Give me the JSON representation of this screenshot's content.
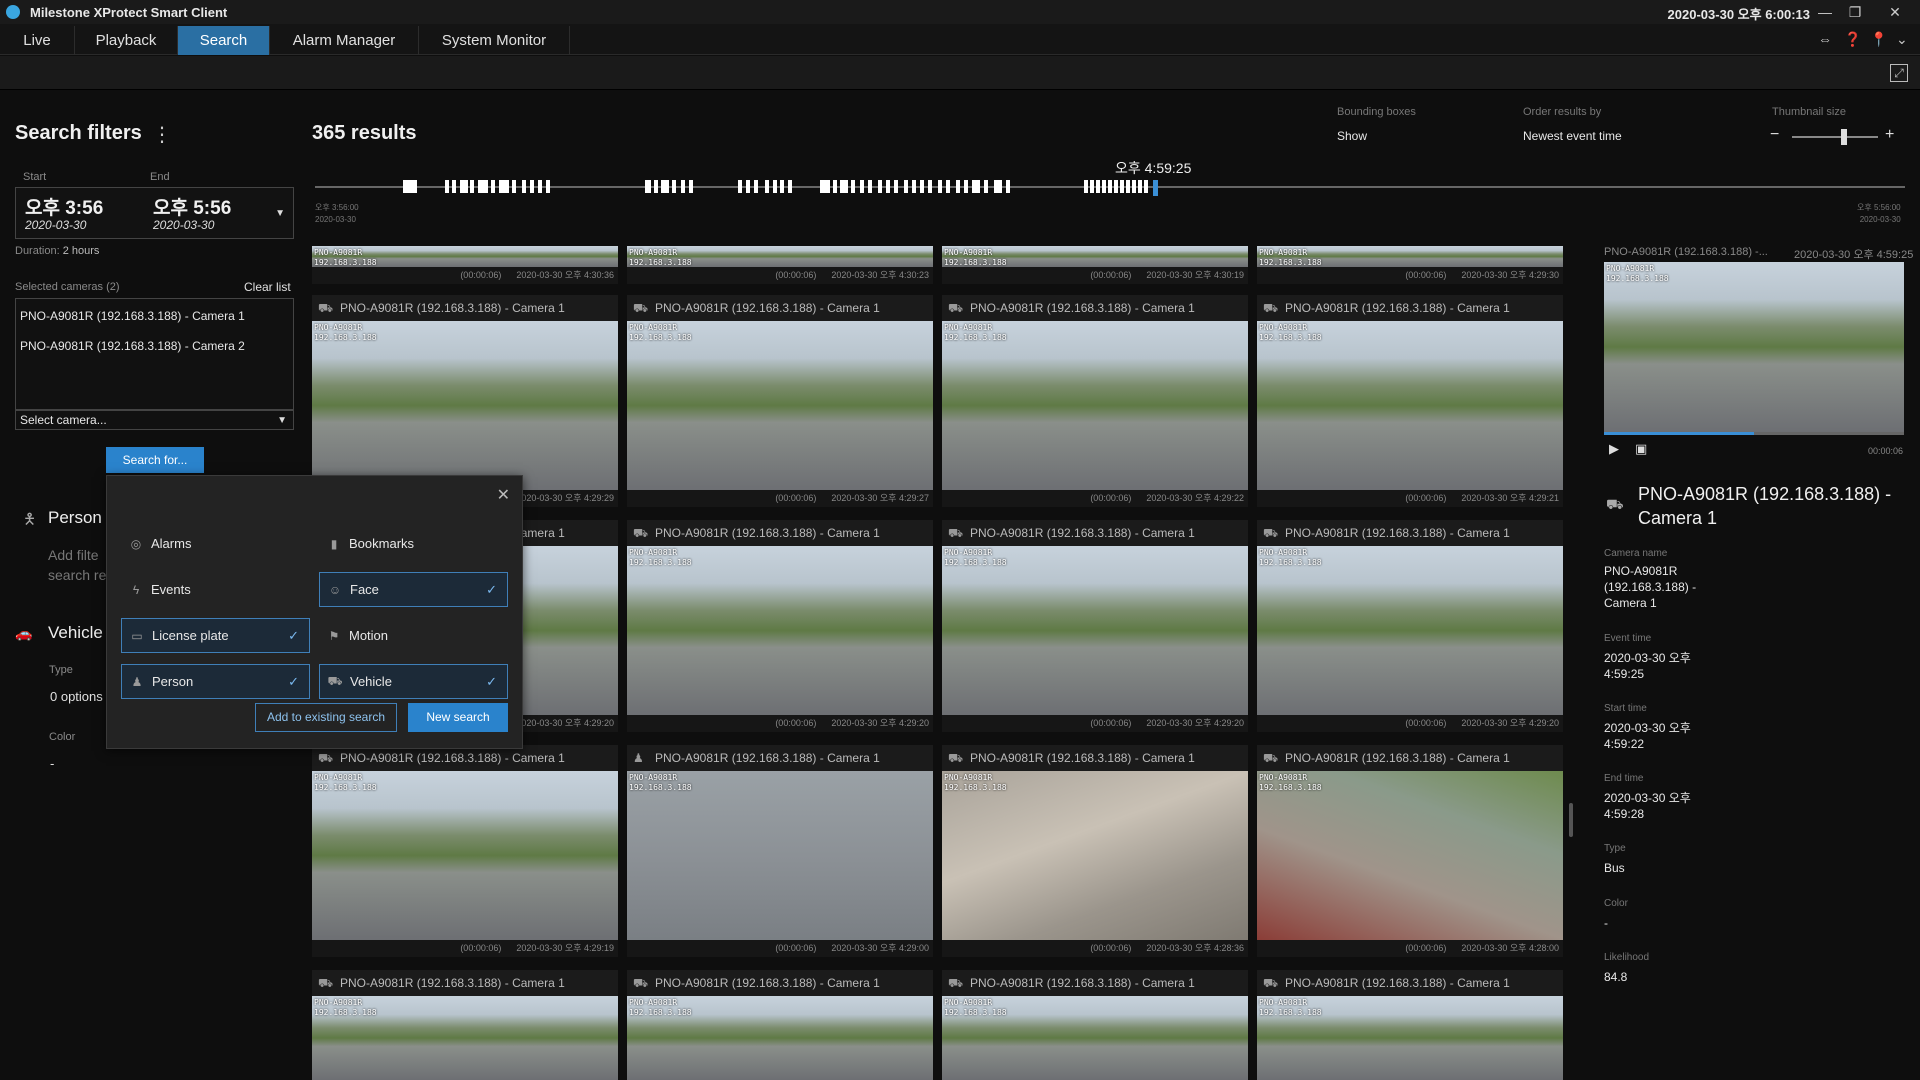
{
  "app": {
    "title": "Milestone XProtect Smart Client",
    "datetime": "2020-03-30 오후 6:00:13",
    "tabs": [
      "Live",
      "Playback",
      "Search",
      "Alarm Manager",
      "System Monitor"
    ]
  },
  "filters": {
    "title": "Search filters",
    "start_label": "Start",
    "end_label": "End",
    "start_time": "오후 3:56",
    "start_date": "2020-03-30",
    "end_time": "오후 5:56",
    "end_date": "2020-03-30",
    "duration_label": "Duration:",
    "duration_value": "2 hours",
    "selected_cameras_label": "Selected cameras (2)",
    "clear_list": "Clear list",
    "cameras": [
      "PNO-A9081R (192.168.3.188) - Camera 1",
      "PNO-A9081R (192.168.3.188) - Camera 2"
    ],
    "select_camera": "Select camera...",
    "search_for": "Search for...",
    "person_title": "Person",
    "person_hint_1": "Add filte",
    "person_hint_2": "search re",
    "vehicle_title": "Vehicle",
    "type_label": "Type",
    "type_value": "0 options",
    "color_label": "Color",
    "color_value": "-"
  },
  "popup": {
    "items": {
      "alarms": "Alarms",
      "bookmarks": "Bookmarks",
      "events": "Events",
      "face": "Face",
      "license_plate": "License plate",
      "motion": "Motion",
      "person": "Person",
      "vehicle": "Vehicle"
    },
    "add_existing": "Add to existing search",
    "new_search": "New search"
  },
  "results": {
    "count": "365 results",
    "bounding_label": "Bounding boxes",
    "bounding_value": "Show",
    "order_label": "Order results by",
    "order_value": "Newest event time",
    "thumb_label": "Thumbnail size",
    "thumbnail_size_level": 0.65,
    "timeline_cursor": "오후 4:59:25",
    "tl_start_time": "오후 3:56:00",
    "tl_start_date": "2020-03-30",
    "tl_end_time": "오후 5:56:00",
    "tl_end_date": "2020-03-30",
    "osd_name": "PNO-A9081R",
    "osd_ip": "192.168.3.188",
    "partial_row": [
      {
        "dur": "(00:00:06)",
        "time": "2020-03-30 오후 4:30:36"
      },
      {
        "dur": "(00:00:06)",
        "time": "2020-03-30 오후 4:30:23"
      },
      {
        "dur": "(00:00:06)",
        "time": "2020-03-30 오후 4:30:19"
      },
      {
        "dur": "(00:00:06)",
        "time": "2020-03-30 오후 4:29:30"
      }
    ],
    "tiles": [
      {
        "cam": "PNO-A9081R (192.168.3.188) - Camera 1",
        "dur": "(00:00:06)",
        "time": "2020-03-30 오후 4:29:29"
      },
      {
        "cam": "PNO-A9081R (192.168.3.188) - Camera 1",
        "dur": "(00:00:06)",
        "time": "2020-03-30 오후 4:29:27"
      },
      {
        "cam": "PNO-A9081R (192.168.3.188) - Camera 1",
        "dur": "(00:00:06)",
        "time": "2020-03-30 오후 4:29:22"
      },
      {
        "cam": "PNO-A9081R (192.168.3.188) - Camera 1",
        "dur": "(00:00:06)",
        "time": "2020-03-30 오후 4:29:21"
      },
      {
        "cam": "PNO-A9081R (192.168.3.188) - Camera 1",
        "dur": "(00:00:06)",
        "time": "2020-03-30 오후 4:29:20"
      },
      {
        "cam": "PNO-A9081R (192.168.3.188) - Camera 1",
        "dur": "(00:00:06)",
        "time": "2020-03-30 오후 4:29:20"
      },
      {
        "cam": "PNO-A9081R (192.168.3.188) - Camera 1",
        "dur": "(00:00:06)",
        "time": "2020-03-30 오후 4:29:20"
      },
      {
        "cam": "PNO-A9081R (192.168.3.188) - Camera 1",
        "dur": "(00:00:06)",
        "time": "2020-03-30 오후 4:29:20"
      },
      {
        "cam": "PNO-A9081R (192.168.3.188) - Camera 1",
        "dur": "(00:00:06)",
        "time": "2020-03-30 오후 4:29:19"
      },
      {
        "cam": "PNO-A9081R (192.168.3.188) - Camera 1",
        "dur": "(00:00:06)",
        "time": "2020-03-30 오후 4:29:00"
      },
      {
        "cam": "PNO-A9081R (192.168.3.188) - Camera 1",
        "dur": "(00:00:06)",
        "time": "2020-03-30 오후 4:28:36"
      },
      {
        "cam": "PNO-A9081R (192.168.3.188) - Camera 1",
        "dur": "(00:00:06)",
        "time": "2020-03-30 오후 4:28:00"
      },
      {
        "cam": "PNO-A9081R (192.168.3.188) - Camera 1",
        "dur": "",
        "time": ""
      },
      {
        "cam": "PNO-A9081R (192.168.3.188) - Camera 1",
        "dur": "",
        "time": ""
      },
      {
        "cam": "PNO-A9081R (192.168.3.188) - Camera 1",
        "dur": "",
        "time": ""
      },
      {
        "cam": "PNO-A9081R (192.168.3.188) - Camera 1",
        "dur": "",
        "time": ""
      }
    ],
    "partial_head": "PNO-A9081R (192.168.3.188) - Camera 1",
    "partial_head_short": "mera 1"
  },
  "detail": {
    "thumb_head": "PNO-A9081R (192.168.3.188) -...",
    "thumb_time": "2020-03-30 오후 4:59:25",
    "duration": "00:00:06",
    "progress": 0.5,
    "title": "PNO-A9081R (192.168.3.188) - Camera 1",
    "camera_name_label": "Camera name",
    "camera_name": "PNO-A9081R (192.168.3.188) - Camera 1",
    "event_time_label": "Event time",
    "event_time": "2020-03-30 오후 4:59:25",
    "start_time_label": "Start time",
    "start_time": "2020-03-30 오후 4:59:22",
    "end_time_label": "End time",
    "end_time": "2020-03-30 오후 4:59:28",
    "type_label": "Type",
    "type": "Bus",
    "color_label": "Color",
    "color": "-",
    "likelihood_label": "Likelihood",
    "likelihood": "84.8"
  },
  "colors": {
    "accent": "#2a83cc",
    "selected_border": "#3f7fb8",
    "background": "#0e0e0e"
  }
}
